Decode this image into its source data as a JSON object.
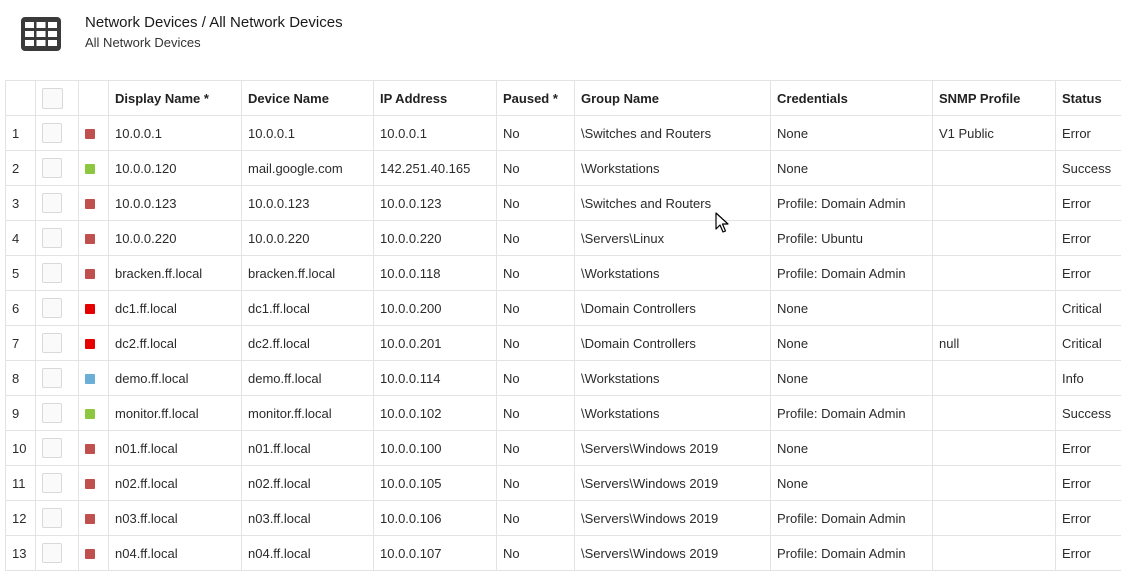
{
  "header": {
    "icon": "table-grid-icon",
    "title": "Network Devices / All Network Devices",
    "subtitle": "All Network Devices"
  },
  "table": {
    "columns": [
      "",
      "",
      "",
      "Display Name *",
      "Device Name",
      "IP Address",
      "Paused *",
      "Group Name",
      "Credentials",
      "SNMP Profile",
      "Status"
    ],
    "rows": [
      {
        "num": "1",
        "color": "#c0504d",
        "display_name": "10.0.0.1",
        "device_name": "10.0.0.1",
        "ip": "10.0.0.1",
        "paused": "No",
        "group": "\\Switches and Routers",
        "credentials": "None",
        "snmp": "V1 Public",
        "status": "Error"
      },
      {
        "num": "2",
        "color": "#8dc63f",
        "display_name": "10.0.0.120",
        "device_name": "mail.google.com",
        "ip": "142.251.40.165",
        "paused": "No",
        "group": "\\Workstations",
        "credentials": "None",
        "snmp": "",
        "status": "Success"
      },
      {
        "num": "3",
        "color": "#c0504d",
        "display_name": "10.0.0.123",
        "device_name": "10.0.0.123",
        "ip": "10.0.0.123",
        "paused": "No",
        "group": "\\Switches and Routers",
        "credentials": "Profile: Domain Admin",
        "snmp": "",
        "status": "Error"
      },
      {
        "num": "4",
        "color": "#c0504d",
        "display_name": "10.0.0.220",
        "device_name": "10.0.0.220",
        "ip": "10.0.0.220",
        "paused": "No",
        "group": "\\Servers\\Linux",
        "credentials": "Profile: Ubuntu",
        "snmp": "",
        "status": "Error"
      },
      {
        "num": "5",
        "color": "#c0504d",
        "display_name": "bracken.ff.local",
        "device_name": "bracken.ff.local",
        "ip": "10.0.0.118",
        "paused": "No",
        "group": "\\Workstations",
        "credentials": "Profile: Domain Admin",
        "snmp": "",
        "status": "Error"
      },
      {
        "num": "6",
        "color": "#e60000",
        "display_name": "dc1.ff.local",
        "device_name": "dc1.ff.local",
        "ip": "10.0.0.200",
        "paused": "No",
        "group": "\\Domain Controllers",
        "credentials": "None",
        "snmp": "",
        "status": "Critical"
      },
      {
        "num": "7",
        "color": "#e60000",
        "display_name": "dc2.ff.local",
        "device_name": "dc2.ff.local",
        "ip": "10.0.0.201",
        "paused": "No",
        "group": "\\Domain Controllers",
        "credentials": "None",
        "snmp": "null",
        "status": "Critical"
      },
      {
        "num": "8",
        "color": "#6baed6",
        "display_name": "demo.ff.local",
        "device_name": "demo.ff.local",
        "ip": "10.0.0.114",
        "paused": "No",
        "group": "\\Workstations",
        "credentials": "None",
        "snmp": "",
        "status": "Info"
      },
      {
        "num": "9",
        "color": "#8dc63f",
        "display_name": "monitor.ff.local",
        "device_name": "monitor.ff.local",
        "ip": "10.0.0.102",
        "paused": "No",
        "group": "\\Workstations",
        "credentials": "Profile: Domain Admin",
        "snmp": "",
        "status": "Success"
      },
      {
        "num": "10",
        "color": "#c0504d",
        "display_name": "n01.ff.local",
        "device_name": "n01.ff.local",
        "ip": "10.0.0.100",
        "paused": "No",
        "group": "\\Servers\\Windows 2019",
        "credentials": "None",
        "snmp": "",
        "status": "Error"
      },
      {
        "num": "11",
        "color": "#c0504d",
        "display_name": "n02.ff.local",
        "device_name": "n02.ff.local",
        "ip": "10.0.0.105",
        "paused": "No",
        "group": "\\Servers\\Windows 2019",
        "credentials": "None",
        "snmp": "",
        "status": "Error"
      },
      {
        "num": "12",
        "color": "#c0504d",
        "display_name": "n03.ff.local",
        "device_name": "n03.ff.local",
        "ip": "10.0.0.106",
        "paused": "No",
        "group": "\\Servers\\Windows 2019",
        "credentials": "Profile: Domain Admin",
        "snmp": "",
        "status": "Error"
      },
      {
        "num": "13",
        "color": "#c0504d",
        "display_name": "n04.ff.local",
        "device_name": "n04.ff.local",
        "ip": "10.0.0.107",
        "paused": "No",
        "group": "\\Servers\\Windows 2019",
        "credentials": "Profile: Domain Admin",
        "snmp": "",
        "status": "Error"
      }
    ]
  },
  "cursor": {
    "icon": "mouse-pointer-icon"
  }
}
